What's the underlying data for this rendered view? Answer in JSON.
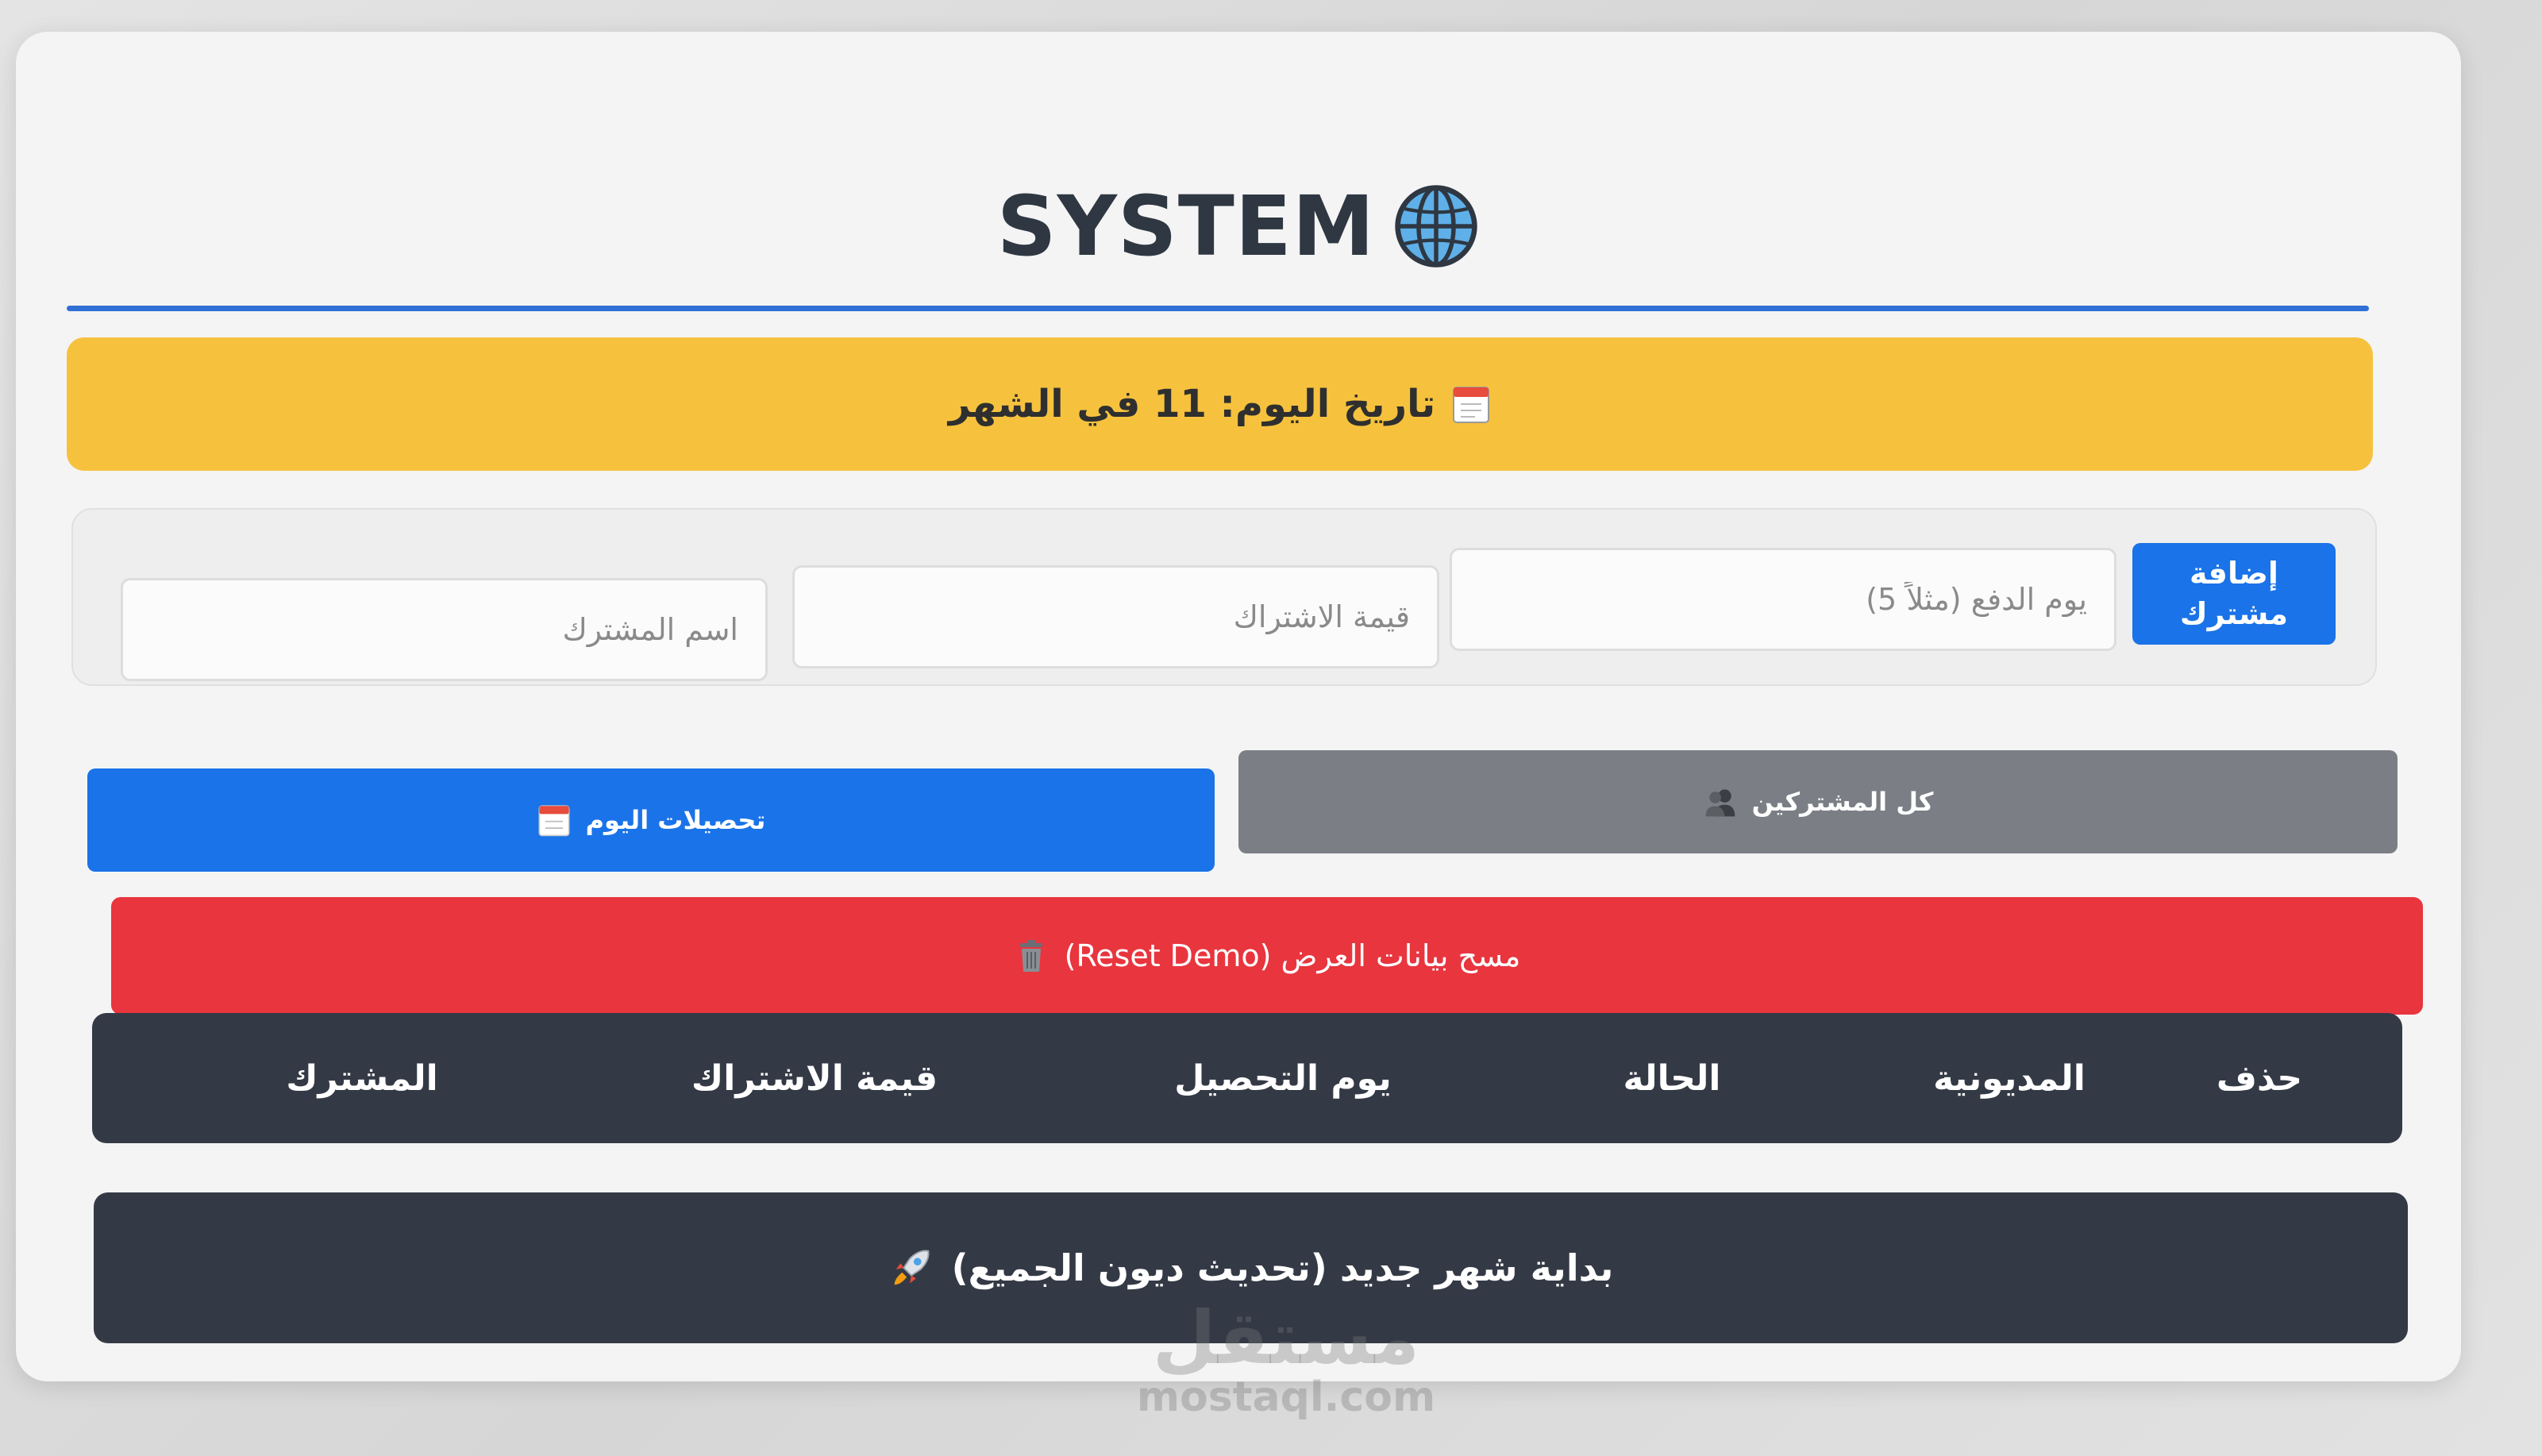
{
  "header": {
    "title": "SYSTEM"
  },
  "date_banner": {
    "text": "تاريخ اليوم: 11 في الشهر"
  },
  "form": {
    "add_button_label": "إضافة مشترك",
    "day_placeholder": "يوم الدفع (مثلاً 5)",
    "amount_placeholder": "قيمة الاشتراك",
    "name_placeholder": "اسم المشترك"
  },
  "actions": {
    "all_subscribers_label": "كل المشتركين",
    "today_collections_label": "تحصيلات اليوم",
    "reset_label": "مسح بيانات العرض (Reset Demo)",
    "new_month_label": "بداية شهر جديد (تحديث ديون الجميع)"
  },
  "table": {
    "columns": [
      "حذف",
      "المديونية",
      "الحالة",
      "يوم التحصيل",
      "قيمة الاشتراك",
      "المشترك"
    ]
  },
  "watermark": {
    "logo": "مستقل",
    "url": "mostaql.com"
  },
  "colors": {
    "accent_blue": "#1a73e8",
    "banner_yellow": "#f6c23e",
    "danger_red": "#e8353e",
    "dark": "#343a45",
    "secondary_gray": "#7b7f85"
  }
}
